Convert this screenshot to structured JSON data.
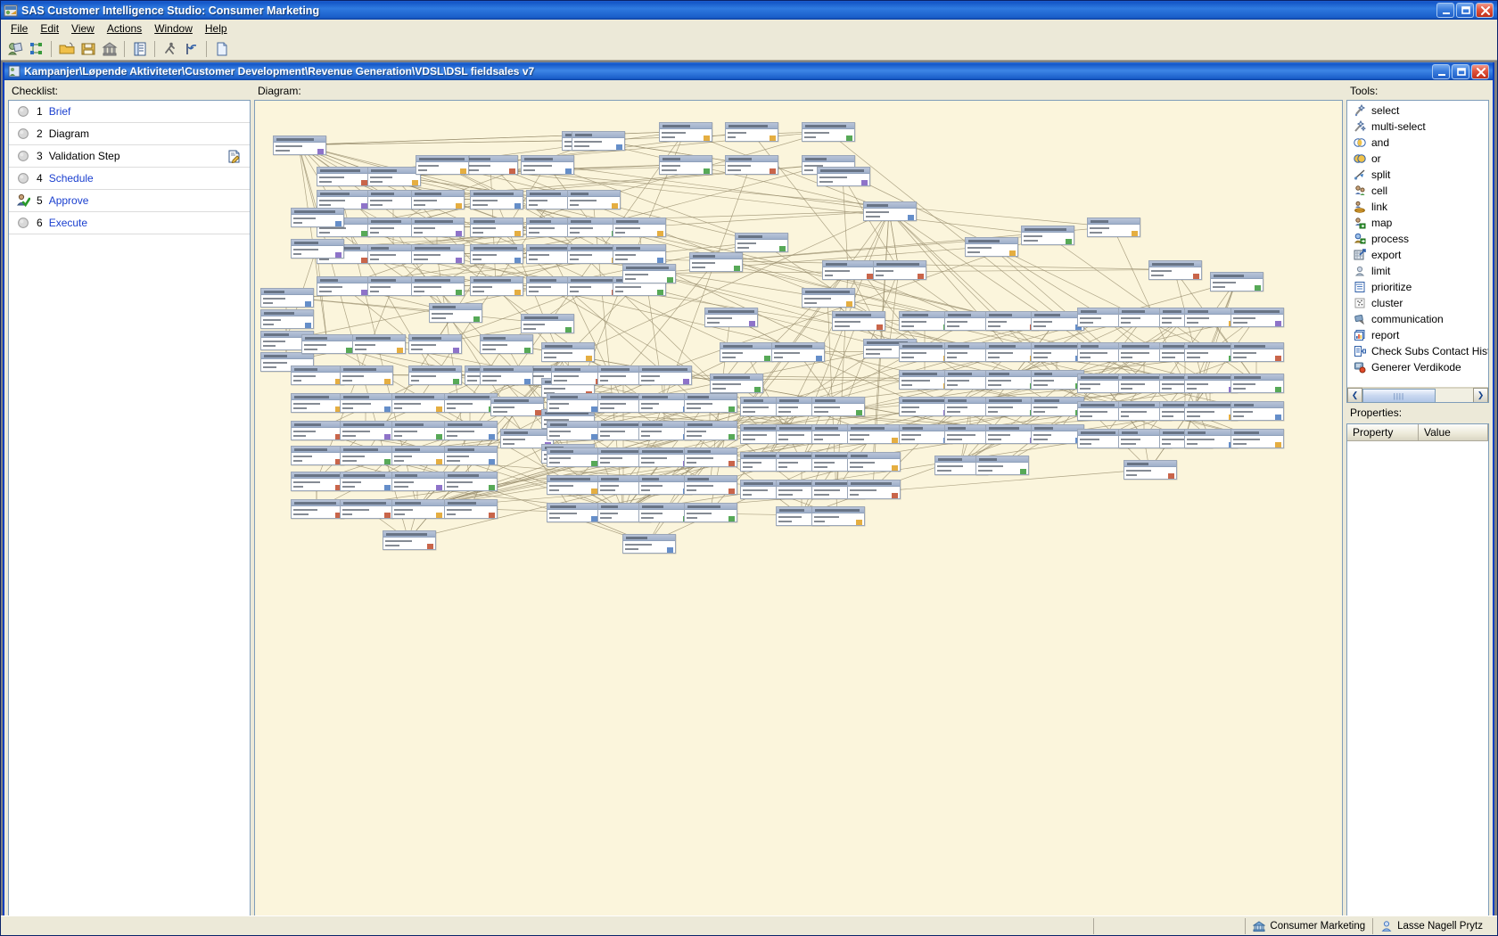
{
  "window": {
    "title": "SAS Customer Intelligence Studio: Consumer Marketing",
    "icon": "sas-app-icon",
    "minimize_label": "_",
    "maximize_label": "❐",
    "close_label": "✕"
  },
  "menubar": {
    "items": [
      {
        "label": "File"
      },
      {
        "label": "Edit"
      },
      {
        "label": "View"
      },
      {
        "label": "Actions"
      },
      {
        "label": "Window"
      },
      {
        "label": "Help"
      }
    ]
  },
  "toolbar": {
    "buttons": [
      {
        "name": "customer-icon",
        "title": "Customers"
      },
      {
        "name": "nodes-icon",
        "title": "Nodes"
      },
      {
        "name": "open-folder-icon",
        "title": "Open"
      },
      {
        "name": "save-icon",
        "title": "Save"
      },
      {
        "name": "institution-icon",
        "title": "Institution"
      },
      {
        "name": "properties-icon",
        "title": "Properties"
      },
      {
        "name": "run-icon",
        "title": "Run"
      },
      {
        "name": "undo-icon",
        "title": "Undo"
      },
      {
        "name": "new-document-icon",
        "title": "New"
      }
    ]
  },
  "child_window": {
    "title": "Kampanjer\\Løpende Aktiviteter\\Customer Development\\Revenue Generation\\VDSL\\DSL fieldsales v7",
    "icon": "campaign-icon",
    "minimize_label": "_",
    "maximize_label": "❐",
    "close_label": "✕"
  },
  "checklist": {
    "label": "Checklist:",
    "items": [
      {
        "number": "1",
        "label": "Brief",
        "style": "link",
        "icon": "circle-grey-icon",
        "action_icon": null
      },
      {
        "number": "2",
        "label": "Diagram",
        "style": "plain",
        "icon": "circle-grey-icon",
        "action_icon": null
      },
      {
        "number": "3",
        "label": "Validation Step",
        "style": "plain",
        "icon": "circle-grey-icon",
        "action_icon": "edit-document-icon"
      },
      {
        "number": "4",
        "label": "Schedule",
        "style": "link",
        "icon": "circle-grey-icon",
        "action_icon": null
      },
      {
        "number": "5",
        "label": "Approve",
        "style": "link",
        "icon": "person-check-icon",
        "action_icon": null
      },
      {
        "number": "6",
        "label": "Execute",
        "style": "link",
        "icon": "circle-grey-icon",
        "action_icon": null
      }
    ]
  },
  "diagram": {
    "label": "Diagram:",
    "background_color": "#fbf5dc",
    "node_header_color": "#a8b6cc",
    "edge_color": "#9a8f6f",
    "scrollbar": {
      "left_arrow": "❮",
      "right_arrow": "❯",
      "thumb_grip": "||||"
    }
  },
  "tools": {
    "label": "Tools:",
    "items": [
      {
        "label": "select",
        "icon": "magic-wand-icon"
      },
      {
        "label": "multi-select",
        "icon": "multi-wand-icon"
      },
      {
        "label": "and",
        "icon": "venn-and-icon"
      },
      {
        "label": "or",
        "icon": "venn-or-icon"
      },
      {
        "label": "split",
        "icon": "split-arrow-icon"
      },
      {
        "label": "cell",
        "icon": "people-cell-icon"
      },
      {
        "label": "link",
        "icon": "link-chain-icon"
      },
      {
        "label": "map",
        "icon": "map-people-icon"
      },
      {
        "label": "process",
        "icon": "process-gear-icon"
      },
      {
        "label": "export",
        "icon": "export-grid-icon"
      },
      {
        "label": "limit",
        "icon": "limit-person-icon"
      },
      {
        "label": "prioritize",
        "icon": "prioritize-list-icon"
      },
      {
        "label": "cluster",
        "icon": "cluster-scatter-icon"
      },
      {
        "label": "communication",
        "icon": "communication-icon"
      },
      {
        "label": "report",
        "icon": "report-chart-icon"
      },
      {
        "label": "Check Subs Contact Hist",
        "icon": "check-subs-icon"
      },
      {
        "label": "Generer Verdikode",
        "icon": "generate-code-icon"
      }
    ],
    "scrollbar": {
      "left_arrow": "❮",
      "right_arrow": "❯",
      "thumb_grip": "||||"
    }
  },
  "properties": {
    "label": "Properties:",
    "columns": [
      "Property",
      "Value"
    ],
    "rows": []
  },
  "statusbar": {
    "cells": [
      {
        "label": "Consumer Marketing",
        "icon": "institution-icon"
      },
      {
        "label": "Lasse Nagell Prytz",
        "icon": "user-icon"
      }
    ]
  }
}
